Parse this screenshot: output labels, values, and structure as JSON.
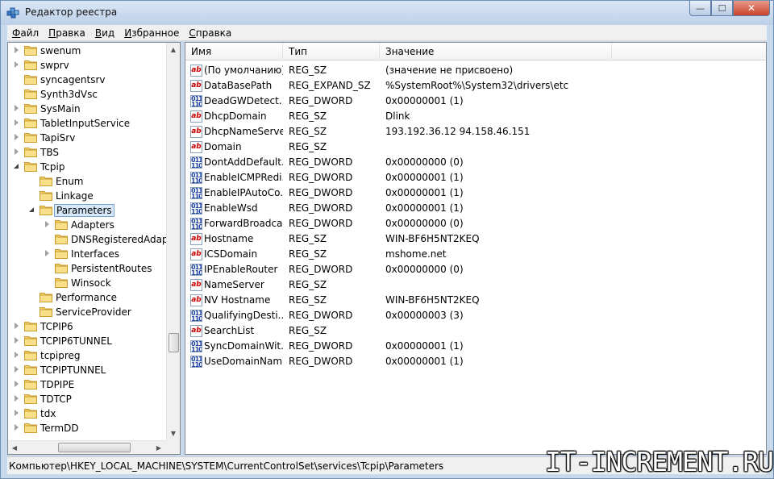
{
  "window": {
    "title": "Редактор реестра",
    "close_label": "✕",
    "min_label": "—",
    "max_label": "☐"
  },
  "menu": [
    {
      "acc": "Ф",
      "rest": "айл"
    },
    {
      "acc": "П",
      "rest": "равка"
    },
    {
      "acc": "В",
      "rest": "ид"
    },
    {
      "acc": "И",
      "rest": "збранное"
    },
    {
      "acc": "С",
      "rest": "правка"
    }
  ],
  "tree": [
    {
      "label": "swenum",
      "level": 0,
      "expander": "closed"
    },
    {
      "label": "swprv",
      "level": 0,
      "expander": "closed"
    },
    {
      "label": "syncagentsrv",
      "level": 0,
      "expander": "none"
    },
    {
      "label": "Synth3dVsc",
      "level": 0,
      "expander": "none"
    },
    {
      "label": "SysMain",
      "level": 0,
      "expander": "closed"
    },
    {
      "label": "TabletInputService",
      "level": 0,
      "expander": "closed"
    },
    {
      "label": "TapiSrv",
      "level": 0,
      "expander": "closed"
    },
    {
      "label": "TBS",
      "level": 0,
      "expander": "closed"
    },
    {
      "label": "Tcpip",
      "level": 0,
      "expander": "open"
    },
    {
      "label": "Enum",
      "level": 1,
      "expander": "none"
    },
    {
      "label": "Linkage",
      "level": 1,
      "expander": "none"
    },
    {
      "label": "Parameters",
      "level": 1,
      "expander": "open",
      "selected": true
    },
    {
      "label": "Adapters",
      "level": 2,
      "expander": "closed"
    },
    {
      "label": "DNSRegisteredAdapte",
      "level": 2,
      "expander": "none"
    },
    {
      "label": "Interfaces",
      "level": 2,
      "expander": "closed"
    },
    {
      "label": "PersistentRoutes",
      "level": 2,
      "expander": "none"
    },
    {
      "label": "Winsock",
      "level": 2,
      "expander": "none"
    },
    {
      "label": "Performance",
      "level": 1,
      "expander": "none"
    },
    {
      "label": "ServiceProvider",
      "level": 1,
      "expander": "none"
    },
    {
      "label": "TCPIP6",
      "level": 0,
      "expander": "closed"
    },
    {
      "label": "TCPIP6TUNNEL",
      "level": 0,
      "expander": "closed"
    },
    {
      "label": "tcpipreg",
      "level": 0,
      "expander": "closed"
    },
    {
      "label": "TCPIPTUNNEL",
      "level": 0,
      "expander": "closed"
    },
    {
      "label": "TDPIPE",
      "level": 0,
      "expander": "closed"
    },
    {
      "label": "TDTCP",
      "level": 0,
      "expander": "closed"
    },
    {
      "label": "tdx",
      "level": 0,
      "expander": "closed"
    },
    {
      "label": "TermDD",
      "level": 0,
      "expander": "closed"
    }
  ],
  "list": {
    "columns": [
      "Имя",
      "Тип",
      "Значение"
    ],
    "rows": [
      {
        "icon": "sz",
        "name": "(По умолчанию)",
        "type": "REG_SZ",
        "value": "(значение не присвоено)"
      },
      {
        "icon": "sz",
        "name": "DataBasePath",
        "type": "REG_EXPAND_SZ",
        "value": "%SystemRoot%\\System32\\drivers\\etc"
      },
      {
        "icon": "bin",
        "name": "DeadGWDetect...",
        "type": "REG_DWORD",
        "value": "0x00000001 (1)"
      },
      {
        "icon": "sz",
        "name": "DhcpDomain",
        "type": "REG_SZ",
        "value": "Dlink"
      },
      {
        "icon": "sz",
        "name": "DhcpNameServer",
        "type": "REG_SZ",
        "value": "193.192.36.12 94.158.46.151"
      },
      {
        "icon": "sz",
        "name": "Domain",
        "type": "REG_SZ",
        "value": ""
      },
      {
        "icon": "bin",
        "name": "DontAddDefault...",
        "type": "REG_DWORD",
        "value": "0x00000000 (0)"
      },
      {
        "icon": "bin",
        "name": "EnableICMPRedi...",
        "type": "REG_DWORD",
        "value": "0x00000001 (1)"
      },
      {
        "icon": "bin",
        "name": "EnableIPAutoCo...",
        "type": "REG_DWORD",
        "value": "0x00000001 (1)"
      },
      {
        "icon": "bin",
        "name": "EnableWsd",
        "type": "REG_DWORD",
        "value": "0x00000001 (1)"
      },
      {
        "icon": "bin",
        "name": "ForwardBroadca...",
        "type": "REG_DWORD",
        "value": "0x00000000 (0)"
      },
      {
        "icon": "sz",
        "name": "Hostname",
        "type": "REG_SZ",
        "value": "WIN-BF6H5NT2KEQ"
      },
      {
        "icon": "sz",
        "name": "ICSDomain",
        "type": "REG_SZ",
        "value": "mshome.net"
      },
      {
        "icon": "bin",
        "name": "IPEnableRouter",
        "type": "REG_DWORD",
        "value": "0x00000000 (0)"
      },
      {
        "icon": "sz",
        "name": "NameServer",
        "type": "REG_SZ",
        "value": ""
      },
      {
        "icon": "sz",
        "name": "NV Hostname",
        "type": "REG_SZ",
        "value": "WIN-BF6H5NT2KEQ"
      },
      {
        "icon": "bin",
        "name": "QualifyingDesti...",
        "type": "REG_DWORD",
        "value": "0x00000003 (3)"
      },
      {
        "icon": "sz",
        "name": "SearchList",
        "type": "REG_SZ",
        "value": ""
      },
      {
        "icon": "bin",
        "name": "SyncDomainWit...",
        "type": "REG_DWORD",
        "value": "0x00000001 (1)"
      },
      {
        "icon": "bin",
        "name": "UseDomainNam...",
        "type": "REG_DWORD",
        "value": "0x00000001 (1)"
      }
    ]
  },
  "icon_text": {
    "sz": "ab",
    "bin": "011 110"
  },
  "status": "Компьютер\\HKEY_LOCAL_MACHINE\\SYSTEM\\CurrentControlSet\\services\\Tcpip\\Parameters",
  "watermark": "IT-INCREMENT.RU"
}
